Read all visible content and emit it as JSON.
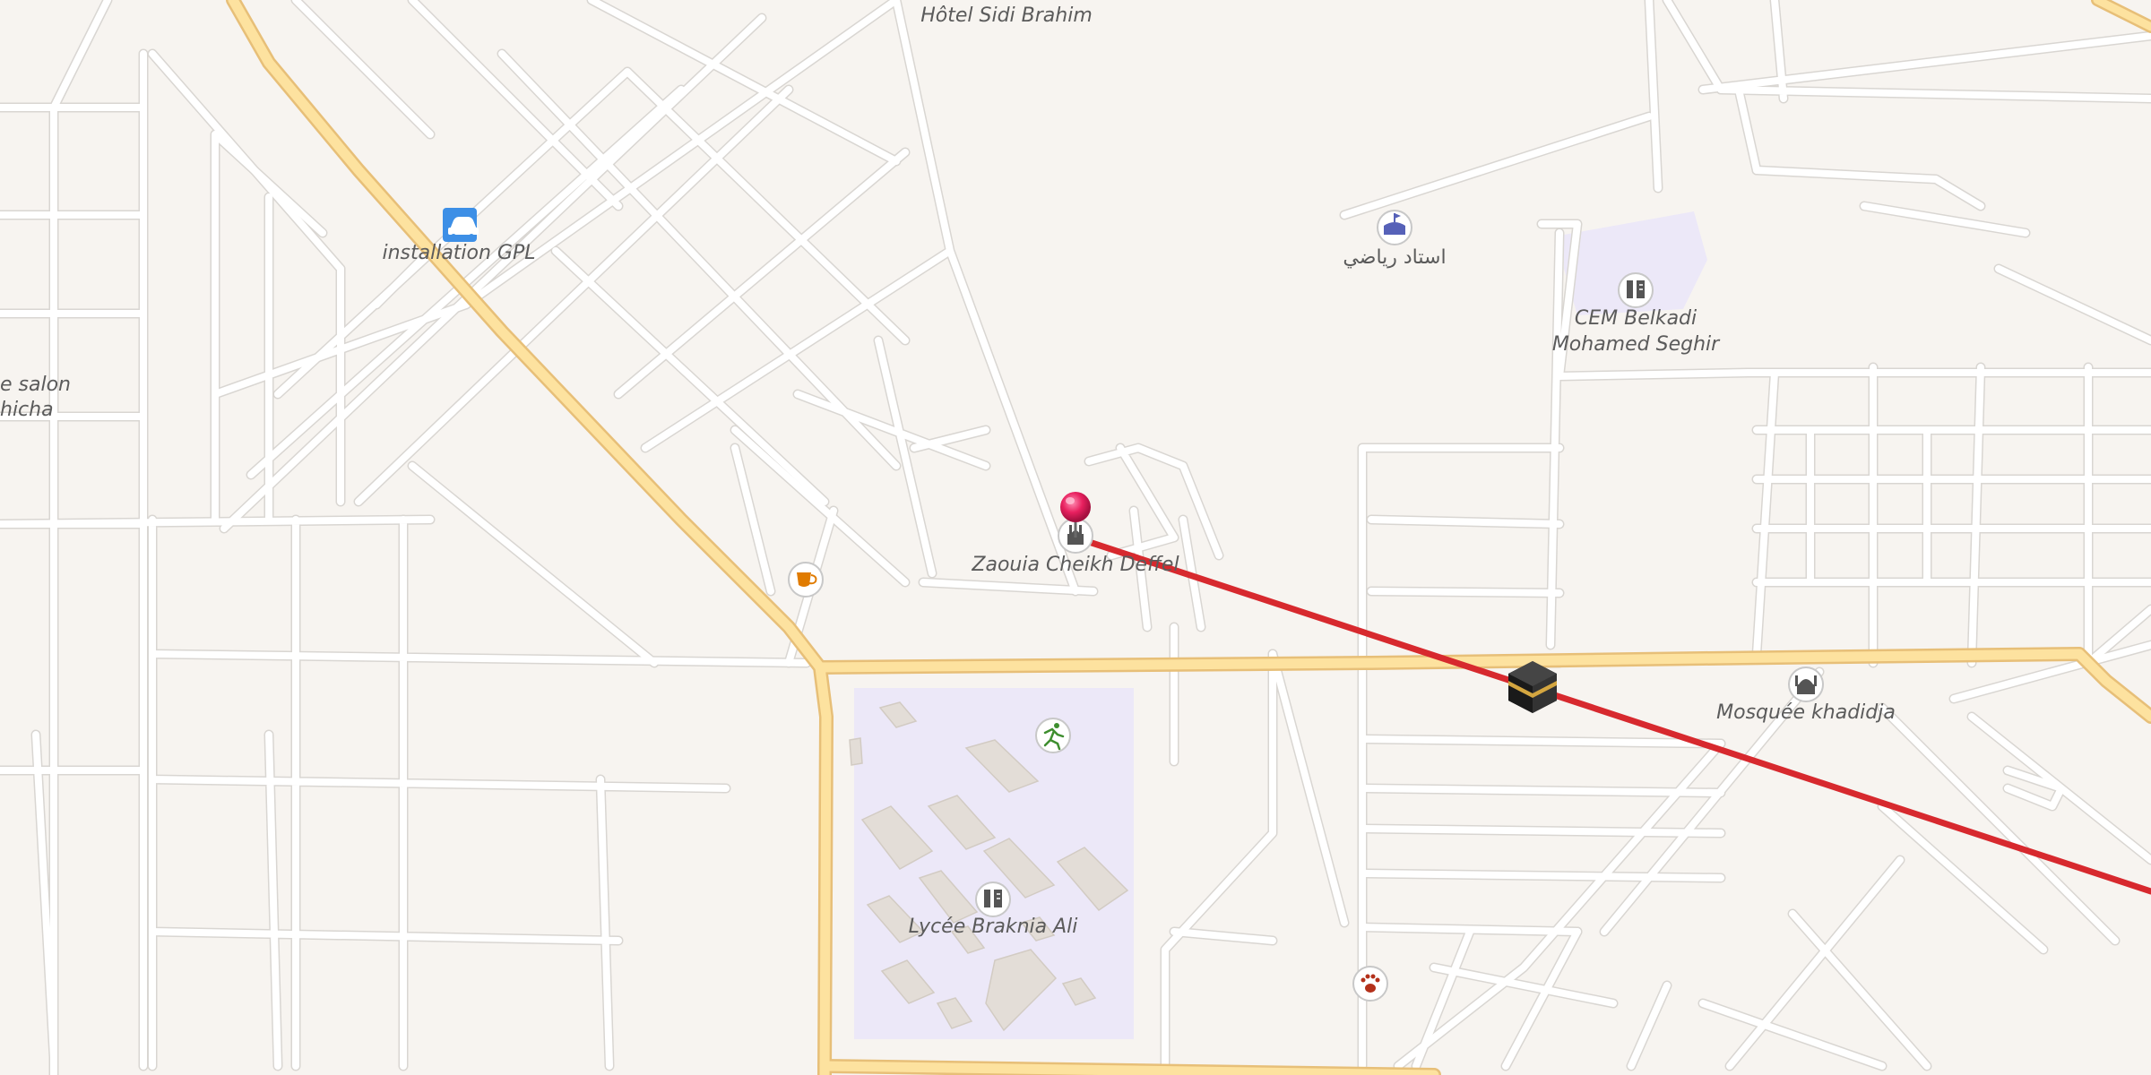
{
  "map": {
    "labels": {
      "hotel": "Hôtel Sidi Brahim",
      "gpl": "installation GPL",
      "salon_line1": "e salon",
      "salon_line2": "hicha",
      "stadium": "استاد رياضي",
      "cem_line1": "CEM Belkadi",
      "cem_line2": "Mohamed Seghir",
      "zaouia": "Zaouia Cheikh Deffel",
      "mosque": "Mosquée khadidja",
      "lycee": "Lycée Braknia Ali"
    },
    "icons": [
      "car-icon",
      "stadium-icon",
      "school-icon",
      "cafe-icon",
      "mosque-icon",
      "sports-icon",
      "veterinary-icon",
      "kaaba-icon",
      "location-pin-icon"
    ],
    "colors": {
      "background": "#f7f4f0",
      "minor_road": "#ffffff",
      "road_casing": "#d9d6d2",
      "major_road": "#fde29f",
      "major_road_casing": "#e7bf78",
      "school_area": "#ece8f8",
      "qibla_line": "#d7292e",
      "pin": "#e8205f"
    }
  }
}
